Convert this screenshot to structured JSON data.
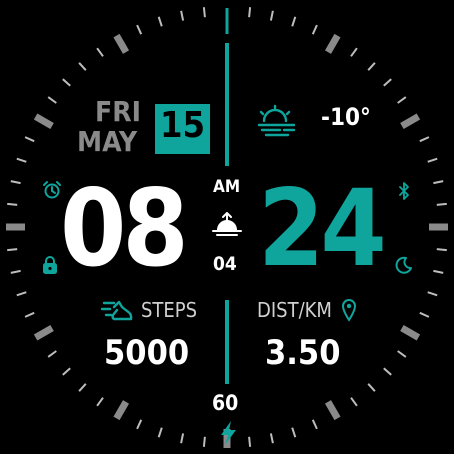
{
  "date": {
    "day_of_week": "FRI",
    "month": "MAY",
    "day": "15"
  },
  "weather": {
    "temperature": "-10°",
    "icon": "weather-fog-icon"
  },
  "time": {
    "hours": "08",
    "minutes": "24",
    "period": "AM",
    "seconds": "04"
  },
  "steps": {
    "label": "STEPS",
    "value": "5000",
    "icon": "steps-shoe-icon"
  },
  "distance": {
    "label": "DIST/KM",
    "value": "3.50",
    "icon": "location-pin-icon"
  },
  "battery": {
    "value": "60",
    "icon": "lightning-bolt-icon"
  },
  "status_icons": [
    "alarm-icon",
    "lock-icon",
    "bluetooth-icon",
    "moon-icon",
    "sunrise-icon"
  ],
  "colors": {
    "accent": "#0fa59c",
    "text": "#ffffff",
    "muted": "#8a8a8a",
    "background": "#000000"
  }
}
